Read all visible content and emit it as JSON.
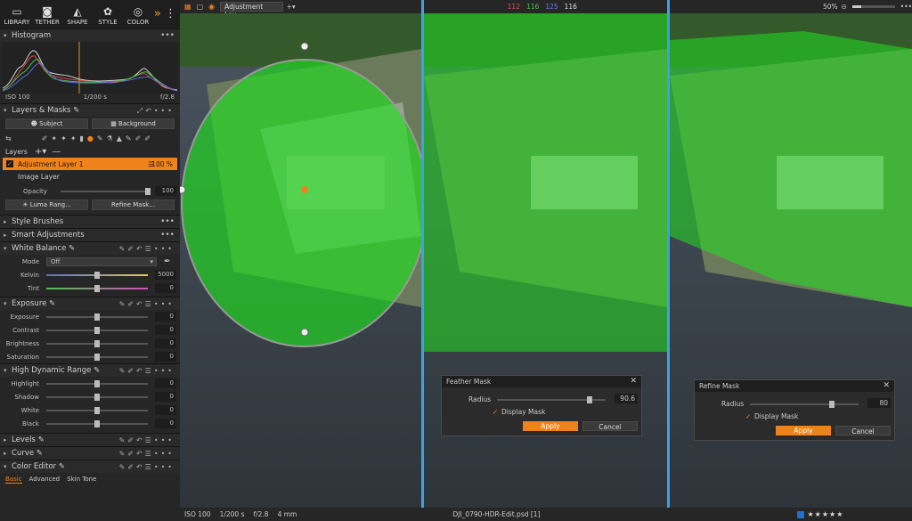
{
  "tooltabs": [
    {
      "label": "LIBRARY",
      "icon": "folder-icon"
    },
    {
      "label": "TETHER",
      "icon": "camera-icon"
    },
    {
      "label": "SHAPE",
      "icon": "shape-icon"
    },
    {
      "label": "STYLE",
      "icon": "style-icon"
    },
    {
      "label": "COLOR",
      "icon": "color-icon"
    }
  ],
  "histogram": {
    "title": "Histogram",
    "iso": "ISO 100",
    "shutter": "1/200 s",
    "aperture": "f/2.8"
  },
  "layers_masks": {
    "title": "Layers & Masks",
    "subject": "Subject",
    "background": "Background",
    "layers_label": "Layers",
    "adj_layer": "Adjustment Layer 1",
    "adj_opacity": "100 %",
    "image_layer": "Image Layer",
    "opacity_label": "Opacity",
    "opacity_value": "100",
    "luma_btn": "Luma Rang...",
    "refine_btn": "Refine Mask..."
  },
  "sections": {
    "style_brushes": "Style Brushes",
    "smart_adjustments": "Smart Adjustments",
    "white_balance": "White Balance",
    "exposure": "Exposure",
    "hdr": "High Dynamic Range",
    "levels": "Levels",
    "curve": "Curve",
    "color_editor": "Color Editor"
  },
  "white_balance": {
    "mode_label": "Mode",
    "mode_value": "Off",
    "kelvin_label": "Kelvin",
    "kelvin_value": "5000",
    "kelvin_level": 0.5,
    "tint_label": "Tint",
    "tint_value": "0",
    "tint_level": 0.5
  },
  "exposure": {
    "sliders": [
      {
        "label": "Exposure",
        "value": "0"
      },
      {
        "label": "Contrast",
        "value": "0"
      },
      {
        "label": "Brightness",
        "value": "0"
      },
      {
        "label": "Saturation",
        "value": "0"
      }
    ]
  },
  "hdr": {
    "sliders": [
      {
        "label": "Highlight",
        "value": "0"
      },
      {
        "label": "Shadow",
        "value": "0"
      },
      {
        "label": "White",
        "value": "0"
      },
      {
        "label": "Black",
        "value": "0"
      }
    ]
  },
  "color_editor_tabs": [
    "Basic",
    "Advanced",
    "Skin Tone"
  ],
  "topbar": {
    "layer_select": "Adjustment Lay...",
    "rgb": {
      "r": "112",
      "g": "116",
      "b": "125",
      "l": "116"
    },
    "zoom": "50%"
  },
  "bottombar": {
    "iso": "ISO 100",
    "shutter": "1/200 s",
    "aperture": "f/2.8",
    "focal": "4 mm",
    "filename": "DJI_0790-HDR-Edit.psd [1]",
    "stars": "★★★★★",
    "color": "#1f6fd1"
  },
  "feather_dialog": {
    "title": "Feather Mask",
    "radius_label": "Radius",
    "radius_value": "90.6",
    "radius_level": 0.85,
    "display_mask": "Display Mask",
    "apply": "Apply",
    "cancel": "Cancel"
  },
  "refine_dialog": {
    "title": "Refine Mask",
    "radius_label": "Radius",
    "radius_value": "80",
    "radius_level": 0.75,
    "display_mask": "Display Mask",
    "apply": "Apply",
    "cancel": "Cancel"
  },
  "colors": {
    "accent": "#f0821c",
    "divider": "#3aa3e8",
    "mask": "#20e020"
  }
}
